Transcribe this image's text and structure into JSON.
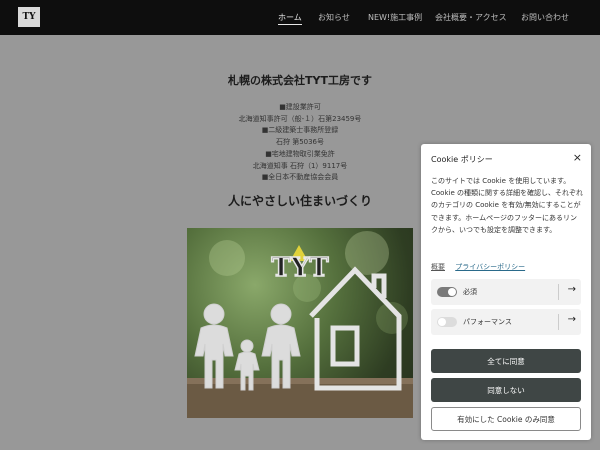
{
  "header": {
    "logo_text": "TY",
    "nav": [
      {
        "label": "ホーム",
        "active": true
      },
      {
        "label": "お知らせ",
        "active": false
      },
      {
        "label": "NEW!施工事例",
        "active": false
      },
      {
        "label": "会社概要・アクセス",
        "active": false
      },
      {
        "label": "お問い合わせ",
        "active": false
      }
    ]
  },
  "main": {
    "title": "札幌の株式会社TYT工房です",
    "info_lines": [
      "■建設業許可",
      "北海道知事許可（般-１）石第23459号",
      "■二級建築士事務所登録",
      "石狩 第5036号",
      "■宅地建物取引業免許",
      "北海道知事 石狩（1）9117号",
      "■全日本不動産協会会員"
    ],
    "tagline": "人にやさしい住まいづくり",
    "photo_logo": "TYT"
  },
  "cookie": {
    "title": "Cookie ポリシー",
    "close_icon": "×",
    "description": "このサイトでは Cookie を使用しています。Cookie の種類に関する詳細を確認し、それぞれのカテゴリの Cookie を有効/無効にすることができます。ホームページのフッターにあるリンクから、いつでも設定を調整できます。",
    "link_summary": "概要",
    "link_privacy": "プライバシーポリシー",
    "categories": [
      {
        "label": "必須",
        "enabled": true
      },
      {
        "label": "パフォーマンス",
        "enabled": false
      }
    ],
    "arrow_icon": "→",
    "btn_accept_all": "全てに同意",
    "btn_decline": "同意しない",
    "btn_accept_selected": "有効にした Cookie のみ同意"
  }
}
